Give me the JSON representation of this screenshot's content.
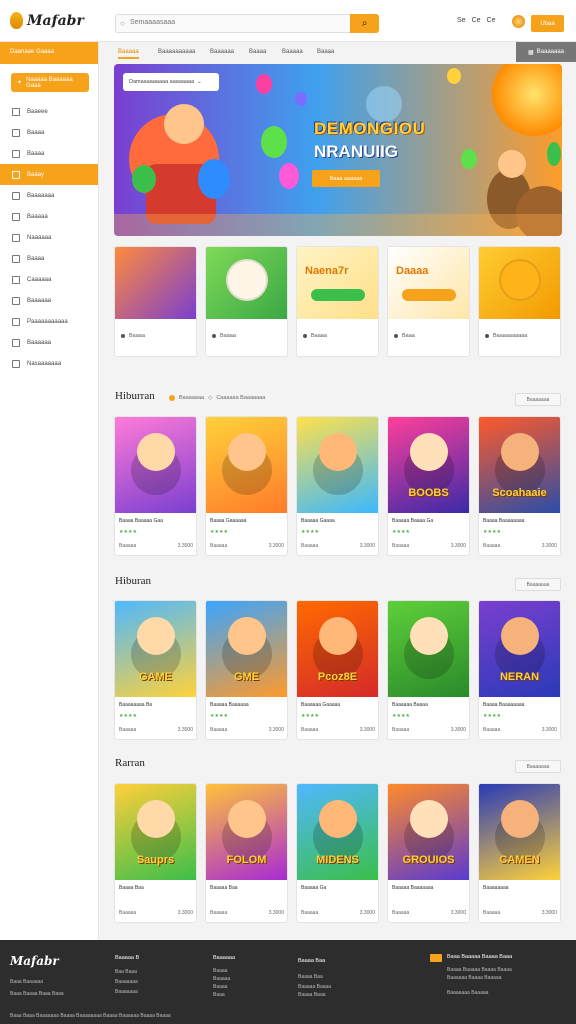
{
  "header": {
    "logo_text": "Mafabr",
    "search_placeholder": "Semaaaasaaa",
    "actions": [
      "Se",
      "Ce",
      "Ce"
    ],
    "login_label": "Ubaa"
  },
  "sidebar": {
    "header_label": "Daanaae Gaaaa",
    "cta_label": "Naaaaa Baaaaaa Gaaa",
    "items": [
      {
        "label": "Baaeee",
        "active": false
      },
      {
        "label": "Baaaa",
        "active": false
      },
      {
        "label": "Baaaa",
        "active": false
      },
      {
        "label": "Baaay",
        "active": true
      },
      {
        "label": "Baaaaaaa",
        "active": false
      },
      {
        "label": "Baaaaa",
        "active": false
      },
      {
        "label": "Naaaaaa",
        "active": false
      },
      {
        "label": "Baaaa",
        "active": false
      },
      {
        "label": "Caaaaaa",
        "active": false
      },
      {
        "label": "Baaaaaa",
        "active": false
      },
      {
        "label": "Paaaaaaaaaaa",
        "active": false
      },
      {
        "label": "Baaaaaa",
        "active": false
      },
      {
        "label": "Nasaaaaaaa",
        "active": false
      }
    ]
  },
  "catnav": {
    "tabs": [
      "Baaaaa",
      "Baaaaaaaaaa",
      "Baaaaaa",
      "Baaaa",
      "Baaaaa",
      "Baaaa"
    ],
    "right_label": "Baaaaaaa"
  },
  "hero": {
    "pill_label": "Damaaaaaaaaa aaaaaaaa",
    "title": "DEMONGIOU",
    "subtitle": "NRANUIIG",
    "button_label": "Baaa aaaaaa"
  },
  "promos": [
    {
      "caption": "Baaaa",
      "art_text": ""
    },
    {
      "caption": "Baaaa",
      "art_text": ""
    },
    {
      "caption": "Baaaa",
      "art_text": "Naena7r"
    },
    {
      "caption": "Baaa",
      "art_text": "Daaaa"
    },
    {
      "caption": "Baaaaaaaaaa",
      "art_text": ""
    }
  ],
  "sections": [
    {
      "title": "Hiburran",
      "sub_a": "Baaaaaaa",
      "sub_b": "Caaaaaa Baaaaaaa",
      "button": "Baaaaaaa",
      "cards": [
        {
          "name": "Baaaa Baaaaa Gaa",
          "rating": "★★★★",
          "meta_left": "Baaaaa",
          "meta_right": "3.3000",
          "art_text": ""
        },
        {
          "name": "Baaaa Gaaaaaa",
          "rating": "★★★★",
          "meta_left": "Baaaaa",
          "meta_right": "3.3000",
          "art_text": ""
        },
        {
          "name": "Baaaaa Gaaaa",
          "rating": "★★★★",
          "meta_left": "Baaaaa",
          "meta_right": "3.3000",
          "art_text": ""
        },
        {
          "name": "Baaaaa Baaaa Ga",
          "rating": "★★★★",
          "meta_left": "Baaaaa",
          "meta_right": "3.3000",
          "art_text": "BOOBS"
        },
        {
          "name": "Baaaa Baaaaaaaa",
          "rating": "★★★★",
          "meta_left": "Baaaaa",
          "meta_right": "3.3000",
          "art_text": "Scoahaaie"
        }
      ]
    },
    {
      "title": "Hiburan",
      "sub_a": "",
      "sub_b": "",
      "button": "Baaaaaaa",
      "cards": [
        {
          "name": "Baaaaaaaa Ba",
          "rating": "★★★★",
          "meta_left": "Baaaaa",
          "meta_right": "3.3000",
          "art_text": "GAME"
        },
        {
          "name": "Baaaaa Baaaaaa",
          "rating": "★★★★",
          "meta_left": "Baaaaa",
          "meta_right": "3.3000",
          "art_text": "GME"
        },
        {
          "name": "Baaaaaa Gaaaaa",
          "rating": "★★★★",
          "meta_left": "Baaaaa",
          "meta_right": "3.3000",
          "art_text": "Pcoz8E"
        },
        {
          "name": "Baaaaaa Baaaa",
          "rating": "★★★★",
          "meta_left": "Baaaaa",
          "meta_right": "3.3000",
          "art_text": ""
        },
        {
          "name": "Baaaa Baaaaaaaa",
          "rating": "★★★★",
          "meta_left": "Baaaaa",
          "meta_right": "3.3000",
          "art_text": "NERAN"
        }
      ]
    },
    {
      "title": "Rarran",
      "sub_a": "",
      "sub_b": "",
      "button": "Baaaaaaa",
      "cards": [
        {
          "name": "Baaaa Baa",
          "rating": "",
          "meta_left": "Baaaaa",
          "meta_right": "3.3000",
          "art_text": "Sauprs"
        },
        {
          "name": "Baaaaa Baa",
          "rating": "",
          "meta_left": "Baaaaa",
          "meta_right": "3.3000",
          "art_text": "FOLOM"
        },
        {
          "name": "Baaaaa Ga",
          "rating": "",
          "meta_left": "Baaaaa",
          "meta_right": "3.3000",
          "art_text": "MIDENS"
        },
        {
          "name": "Baaaaa Baaaaaaa",
          "rating": "",
          "meta_left": "Baaaaa",
          "meta_right": "3.3000",
          "art_text": "GROUIOS"
        },
        {
          "name": "Baaaaaaaa",
          "rating": "",
          "meta_left": "Baaaaa",
          "meta_right": "3.3000",
          "art_text": "CAMEN"
        }
      ]
    }
  ],
  "footer": {
    "logo": "Mafabr",
    "tag_lines": [
      "Baaa Baaaaaa",
      "Baaa Baaaa Baaa Baaa"
    ],
    "col1_head": "Baaaaa B",
    "col1": [
      "Baa Baaa",
      "Baaaaaaa",
      "Baaaaaaa"
    ],
    "col2_head": "Baaaaaa",
    "col2": [
      "Baaaa",
      "Baaaaa",
      "Baaaa",
      "Baaa"
    ],
    "col3_head": "Baaaa Baa",
    "col3": [
      "Baaaa Baa",
      "Baaaaa Baaaa",
      "Baaaa Baaa"
    ],
    "col4_head": "Baaa Baaaaa Baaaa Baaa",
    "col4": [
      "Baaaa Baaaaa Baaaa Baaaa",
      "Baaaaaa Baaaa Baaaaa",
      "Baaaaaaa Baaaaa"
    ],
    "bottom": "Baaa Baaa Baaaaaaa Baaaa Baaaaaaaa Baaaa Baaaaaa Baaaa Baaaa"
  },
  "colors": {
    "accent": "#f7a21b",
    "footer_bg": "#2d2d2d",
    "sidebar_active": "#f7a21b"
  }
}
